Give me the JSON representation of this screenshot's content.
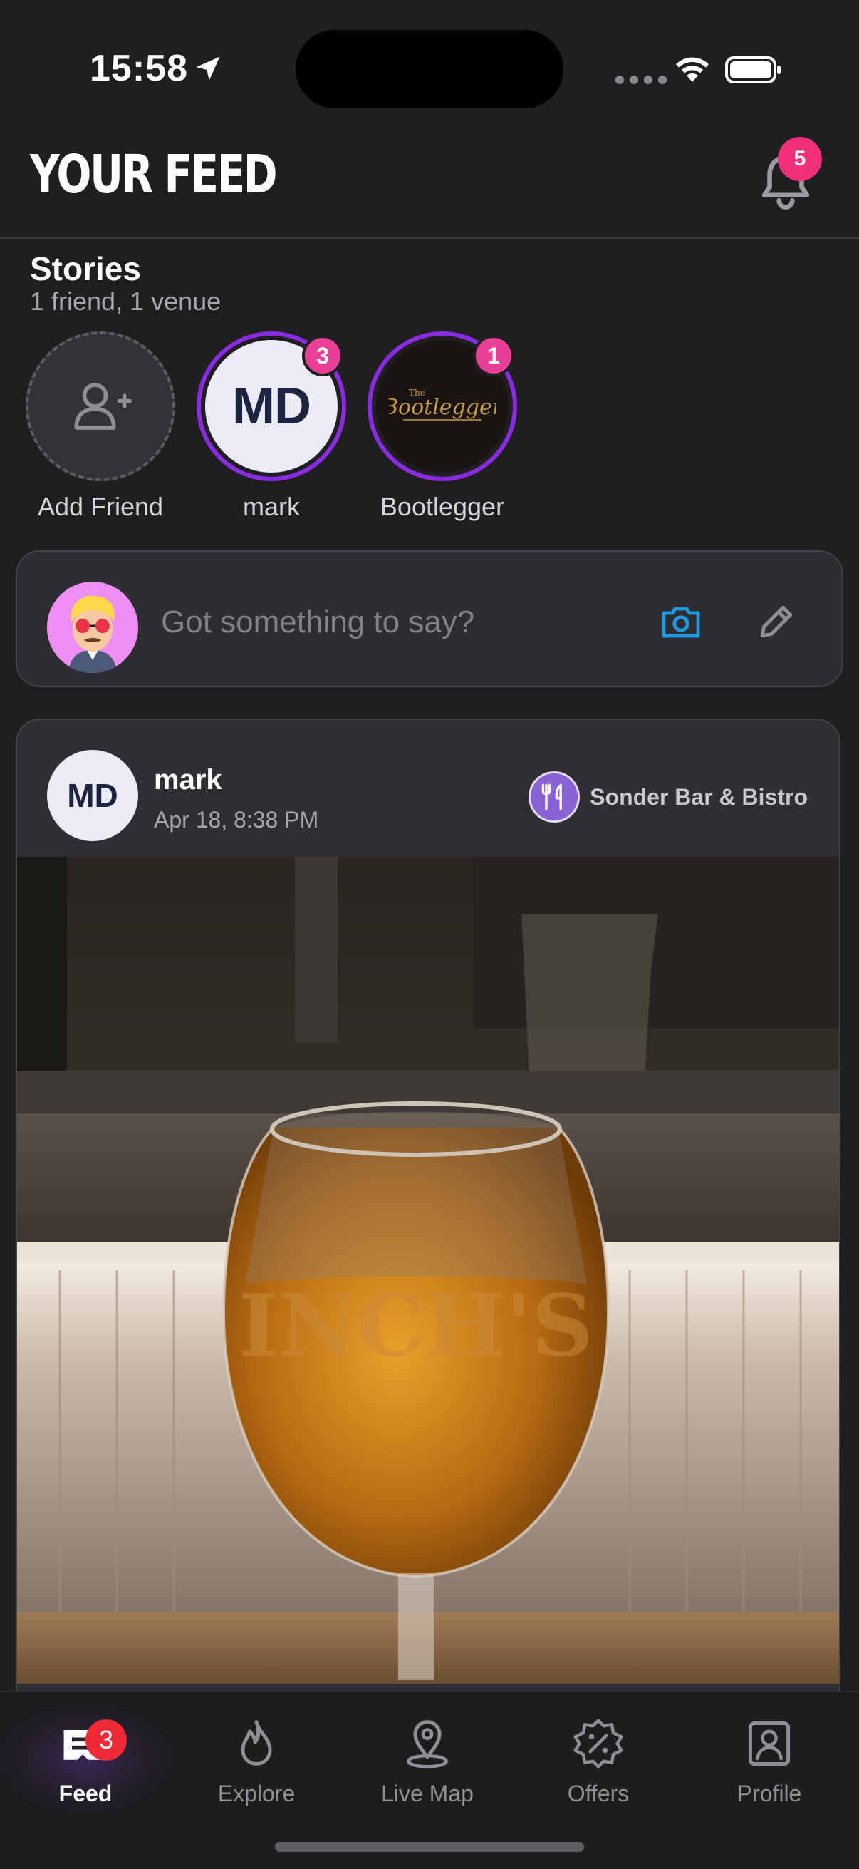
{
  "status_bar": {
    "time": "15:58"
  },
  "header": {
    "title": "YOUR FEED",
    "notification_count": "5"
  },
  "stories": {
    "title": "Stories",
    "subtitle": "1 friend, 1 venue",
    "items": [
      {
        "label": "Add Friend"
      },
      {
        "label": "mark",
        "initials": "MD",
        "badge": "3"
      },
      {
        "label": "Bootlegger",
        "badge": "1",
        "logo_text": "Bootlegger",
        "logo_small": "The"
      }
    ]
  },
  "composer": {
    "placeholder": "Got something to say?"
  },
  "post": {
    "avatar_initials": "MD",
    "author": "mark",
    "time": "Apr 18, 8:38 PM",
    "venue": "Sonder Bar & Bistro"
  },
  "tabs": [
    {
      "label": "Feed",
      "badge": "3",
      "active": true,
      "icon": "feed-icon"
    },
    {
      "label": "Explore",
      "icon": "flame-icon"
    },
    {
      "label": "Live Map",
      "icon": "map-pin-icon"
    },
    {
      "label": "Offers",
      "icon": "discount-icon"
    },
    {
      "label": "Profile",
      "icon": "profile-icon"
    }
  ],
  "colors": {
    "accent": "#8a2be2",
    "badge": "#ef2f7a",
    "camera": "#1e9be0",
    "background": "#1f1e21"
  }
}
